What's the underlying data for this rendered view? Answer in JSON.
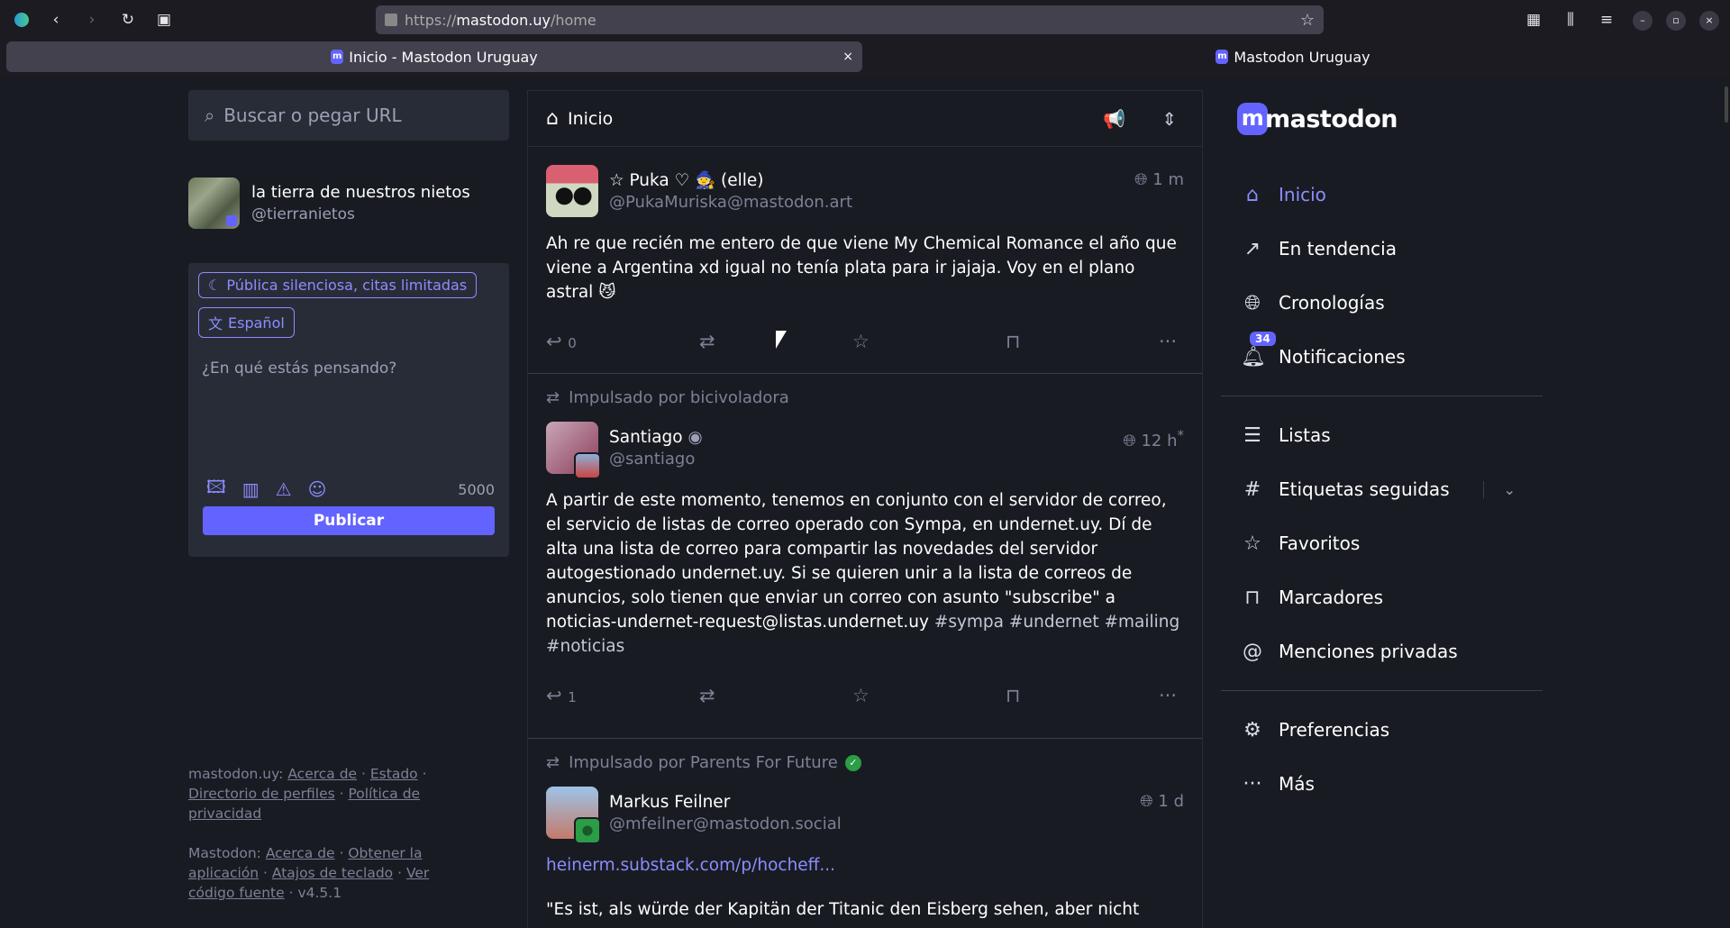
{
  "browser": {
    "url_scheme": "https://",
    "url_host": "mastodon.uy",
    "url_path": "/home",
    "tabs": [
      {
        "title": "Inicio - Mastodon Uruguay",
        "close": "×"
      },
      {
        "title": "Mastodon Uruguay"
      }
    ]
  },
  "search": {
    "placeholder": "Buscar o pegar URL"
  },
  "profile": {
    "display_name": "la tierra de nuestros nietos",
    "acct": "@tierranietos"
  },
  "compose": {
    "visibility": "Pública silenciosa, citas limitadas",
    "language": "Español",
    "placeholder": "¿En qué estás pensando?",
    "char_count": "5000",
    "publish": "Publicar"
  },
  "footer": {
    "server_label": "mastodon.uy:",
    "server_links": [
      "Acerca de",
      "Estado",
      "Directorio de perfiles",
      "Política de privacidad"
    ],
    "app_label": "Mastodon:",
    "app_links": [
      "Acerca de",
      "Obtener la aplicación",
      "Atajos de teclado",
      "Ver código fuente"
    ],
    "version": "v4.5.1"
  },
  "column": {
    "title": "Inicio"
  },
  "posts": [
    {
      "name": "☆ Puka ♡ 🧙 (elle)",
      "acct": "@PukaMuriska@mastodon.art",
      "time": "1 m",
      "text": "Ah re que recién me entero de que viene My Chemical Romance el año que viene a Argentina xd igual no tenía plata para ir jajaja. Voy en el plano astral 😼",
      "replies": "0"
    },
    {
      "boosted_by": "Impulsado por bicivoladora",
      "name": "Santiago",
      "acct": "@santiago",
      "time": "12 h",
      "edited": "*",
      "text": "A partir de este momento, tenemos en conjunto con el servidor de correo, el servicio de listas de correo operado con Sympa, en undernet.uy. Dí de alta una lista de correo para compartir las novedades del servidor autogestionado undernet.uy. Si se quieren unir a la lista de correos de anuncios, solo tienen que enviar un correo con asunto \"subscribe\" a noticias-undernet-request@listas.undernet.uy",
      "tags": "#sympa #undernet #mailing #noticias",
      "replies": "1"
    },
    {
      "boosted_by": "Impulsado por Parents For Future",
      "name": "Markus Feilner",
      "acct": "@mfeilner@mastodon.social",
      "time": "1 d",
      "link": "heinerm.substack.com/p/hocheff...",
      "text": "\"Es ist, als würde der Kapitän der Titanic den Eisberg sehen, aber nicht"
    }
  ],
  "nav": {
    "logo": "mastodon",
    "items": [
      {
        "label": "Inicio"
      },
      {
        "label": "En tendencia"
      },
      {
        "label": "Cronologías"
      },
      {
        "label": "Notificaciones",
        "badge": "34"
      },
      {
        "label": "Listas"
      },
      {
        "label": "Etiquetas seguidas"
      },
      {
        "label": "Favoritos"
      },
      {
        "label": "Marcadores"
      },
      {
        "label": "Menciones privadas"
      },
      {
        "label": "Preferencias"
      },
      {
        "label": "Más"
      }
    ]
  },
  "colors": {
    "accent": "#6364ff",
    "accent_light": "#8c8dff",
    "bg": "#191b22",
    "panel": "#282c37",
    "verified": "#2a9d46"
  }
}
